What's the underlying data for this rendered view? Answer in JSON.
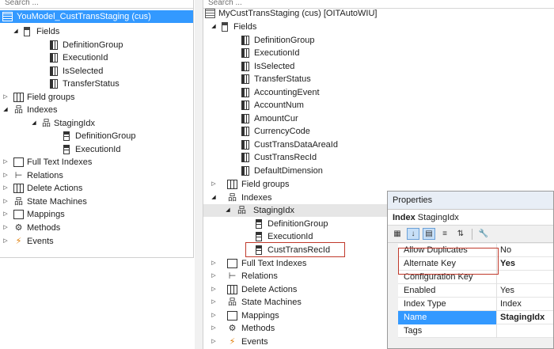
{
  "left_tree": {
    "search_placeholder": "Search ...",
    "rows": [
      {
        "label": "YouModel_CustTransStaging (cus)",
        "icon": "table-icon",
        "expander": ""
      },
      {
        "label": "Fields",
        "icon": "fields-icon",
        "expander": "◢"
      },
      {
        "label": "DefinitionGroup",
        "icon": "field-icon",
        "expander": ""
      },
      {
        "label": "ExecutionId",
        "icon": "field-icon",
        "expander": ""
      },
      {
        "label": "IsSelected",
        "icon": "field-icon",
        "expander": ""
      },
      {
        "label": "TransferStatus",
        "icon": "field-icon",
        "expander": ""
      },
      {
        "label": "Field groups",
        "icon": "field-groups-icon",
        "expander": "▷"
      },
      {
        "label": "Indexes",
        "icon": "indexes-icon",
        "expander": "◢"
      },
      {
        "label": "StagingIdx",
        "icon": "index-icon",
        "expander": "◢"
      },
      {
        "label": "DefinitionGroup",
        "icon": "index-field-icon",
        "expander": ""
      },
      {
        "label": "ExecutionId",
        "icon": "index-field-icon",
        "expander": ""
      },
      {
        "label": "Full Text Indexes",
        "icon": "full-text-indexes-icon",
        "expander": "▷"
      },
      {
        "label": "Relations",
        "icon": "relations-icon",
        "expander": "▷"
      },
      {
        "label": "Delete Actions",
        "icon": "delete-actions-icon",
        "expander": "▷"
      },
      {
        "label": "State Machines",
        "icon": "state-machines-icon",
        "expander": "▷"
      },
      {
        "label": "Mappings",
        "icon": "mappings-icon",
        "expander": "▷"
      },
      {
        "label": "Methods",
        "icon": "methods-icon",
        "expander": "▷"
      },
      {
        "label": "Events",
        "icon": "events-icon",
        "expander": "▷"
      }
    ]
  },
  "right_tree": {
    "search_placeholder": "Search ...",
    "rows": [
      {
        "label": "MyCustTransStaging (cus) [OITAutoWIU]",
        "icon": "table-icon",
        "expander": ""
      },
      {
        "label": "Fields",
        "icon": "fields-icon",
        "expander": "◢"
      },
      {
        "label": "DefinitionGroup",
        "icon": "field-icon",
        "expander": ""
      },
      {
        "label": "ExecutionId",
        "icon": "field-icon",
        "expander": ""
      },
      {
        "label": "IsSelected",
        "icon": "field-icon",
        "expander": ""
      },
      {
        "label": "TransferStatus",
        "icon": "field-icon",
        "expander": ""
      },
      {
        "label": "AccountingEvent",
        "icon": "field-icon",
        "expander": ""
      },
      {
        "label": "AccountNum",
        "icon": "field-icon",
        "expander": ""
      },
      {
        "label": "AmountCur",
        "icon": "field-icon",
        "expander": ""
      },
      {
        "label": "CurrencyCode",
        "icon": "field-icon",
        "expander": ""
      },
      {
        "label": "CustTransDataAreaId",
        "icon": "field-icon",
        "expander": ""
      },
      {
        "label": "CustTransRecId",
        "icon": "field-icon",
        "expander": ""
      },
      {
        "label": "DefaultDimension",
        "icon": "field-icon",
        "expander": ""
      },
      {
        "label": "Field groups",
        "icon": "field-groups-icon",
        "expander": "▷"
      },
      {
        "label": "Indexes",
        "icon": "indexes-icon",
        "expander": "◢"
      },
      {
        "label": "StagingIdx",
        "icon": "index-icon",
        "expander": "◢"
      },
      {
        "label": "DefinitionGroup",
        "icon": "index-field-icon",
        "expander": ""
      },
      {
        "label": "ExecutionId",
        "icon": "index-field-icon",
        "expander": ""
      },
      {
        "label": "CustTransRecId",
        "icon": "index-field-icon",
        "expander": ""
      },
      {
        "label": "Full Text Indexes",
        "icon": "full-text-indexes-icon",
        "expander": "▷"
      },
      {
        "label": "Relations",
        "icon": "relations-icon",
        "expander": "▷"
      },
      {
        "label": "Delete Actions",
        "icon": "delete-actions-icon",
        "expander": "▷"
      },
      {
        "label": "State Machines",
        "icon": "state-machines-icon",
        "expander": "▷"
      },
      {
        "label": "Mappings",
        "icon": "mappings-icon",
        "expander": "▷"
      },
      {
        "label": "Methods",
        "icon": "methods-icon",
        "expander": "▷"
      },
      {
        "label": "Events",
        "icon": "events-icon",
        "expander": "▷"
      }
    ]
  },
  "properties": {
    "title": "Properties",
    "object_type": "Index",
    "object_name": "StagingIdx",
    "rows": [
      {
        "key": "Allow Duplicates",
        "value": "No",
        "bold": false
      },
      {
        "key": "Alternate Key",
        "value": "Yes",
        "bold": true
      },
      {
        "key": "Configuration Key",
        "value": "",
        "bold": false
      },
      {
        "key": "Enabled",
        "value": "Yes",
        "bold": false
      },
      {
        "key": "Index Type",
        "value": "Index",
        "bold": false
      },
      {
        "key": "Name",
        "value": "StagingIdx",
        "bold": true
      },
      {
        "key": "Tags",
        "value": "",
        "bold": false
      }
    ]
  },
  "colors": {
    "selection": "#3399ff",
    "highlight_box": "#c0392b",
    "events_icon": "#e07b00"
  }
}
